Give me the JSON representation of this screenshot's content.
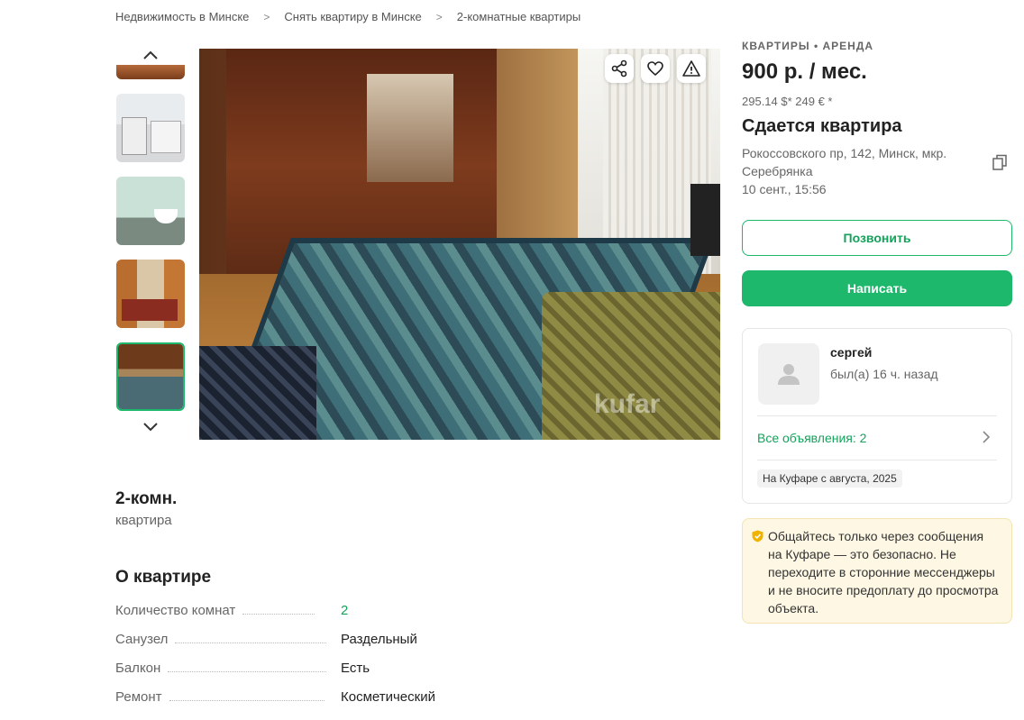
{
  "breadcrumb": [
    "Недвижимость в Минске",
    "Снять квартиру в Минске",
    "2-комнатные квартиры"
  ],
  "breadcrumb_sep": ">",
  "gallery": {
    "thumb_count": 4,
    "active_index": 3,
    "watermark": "kufar"
  },
  "listing": {
    "category": "КВАРТИРЫ • АРЕНДА",
    "price": "900 р. / мес.",
    "alt_price": "295.14 $*  249 € *",
    "title": "Сдается квартира",
    "address": "Рокоссовского пр, 142, Минск, мкр. Серебрянка",
    "date": "10 сент., 15:56"
  },
  "actions": {
    "call": "Позвонить",
    "write": "Написать"
  },
  "seller": {
    "name": "сергей",
    "last_seen": "был(а) 16 ч. назад",
    "all_ads": "Все объявления: 2",
    "since": "На Куфаре с августа, 2025"
  },
  "safety_note": "Общайтесь только через сообщения на Куфаре — это безопасно. Не переходите в сторонние мессенджеры и не вносите предоплату до просмотра объекта.",
  "summary": {
    "title": "2-комн.",
    "subtitle": "квартира"
  },
  "about": {
    "title": "О квартире",
    "rows": [
      {
        "label": "Количество комнат",
        "value": "2"
      },
      {
        "label": "Санузел",
        "value": "Раздельный"
      },
      {
        "label": "Балкон",
        "value": "Есть"
      },
      {
        "label": "Ремонт",
        "value": "Косметический"
      }
    ]
  },
  "colors": {
    "accent": "#1db86b",
    "accent_text": "#14a25b",
    "safety_bg": "#fdf7e3"
  }
}
